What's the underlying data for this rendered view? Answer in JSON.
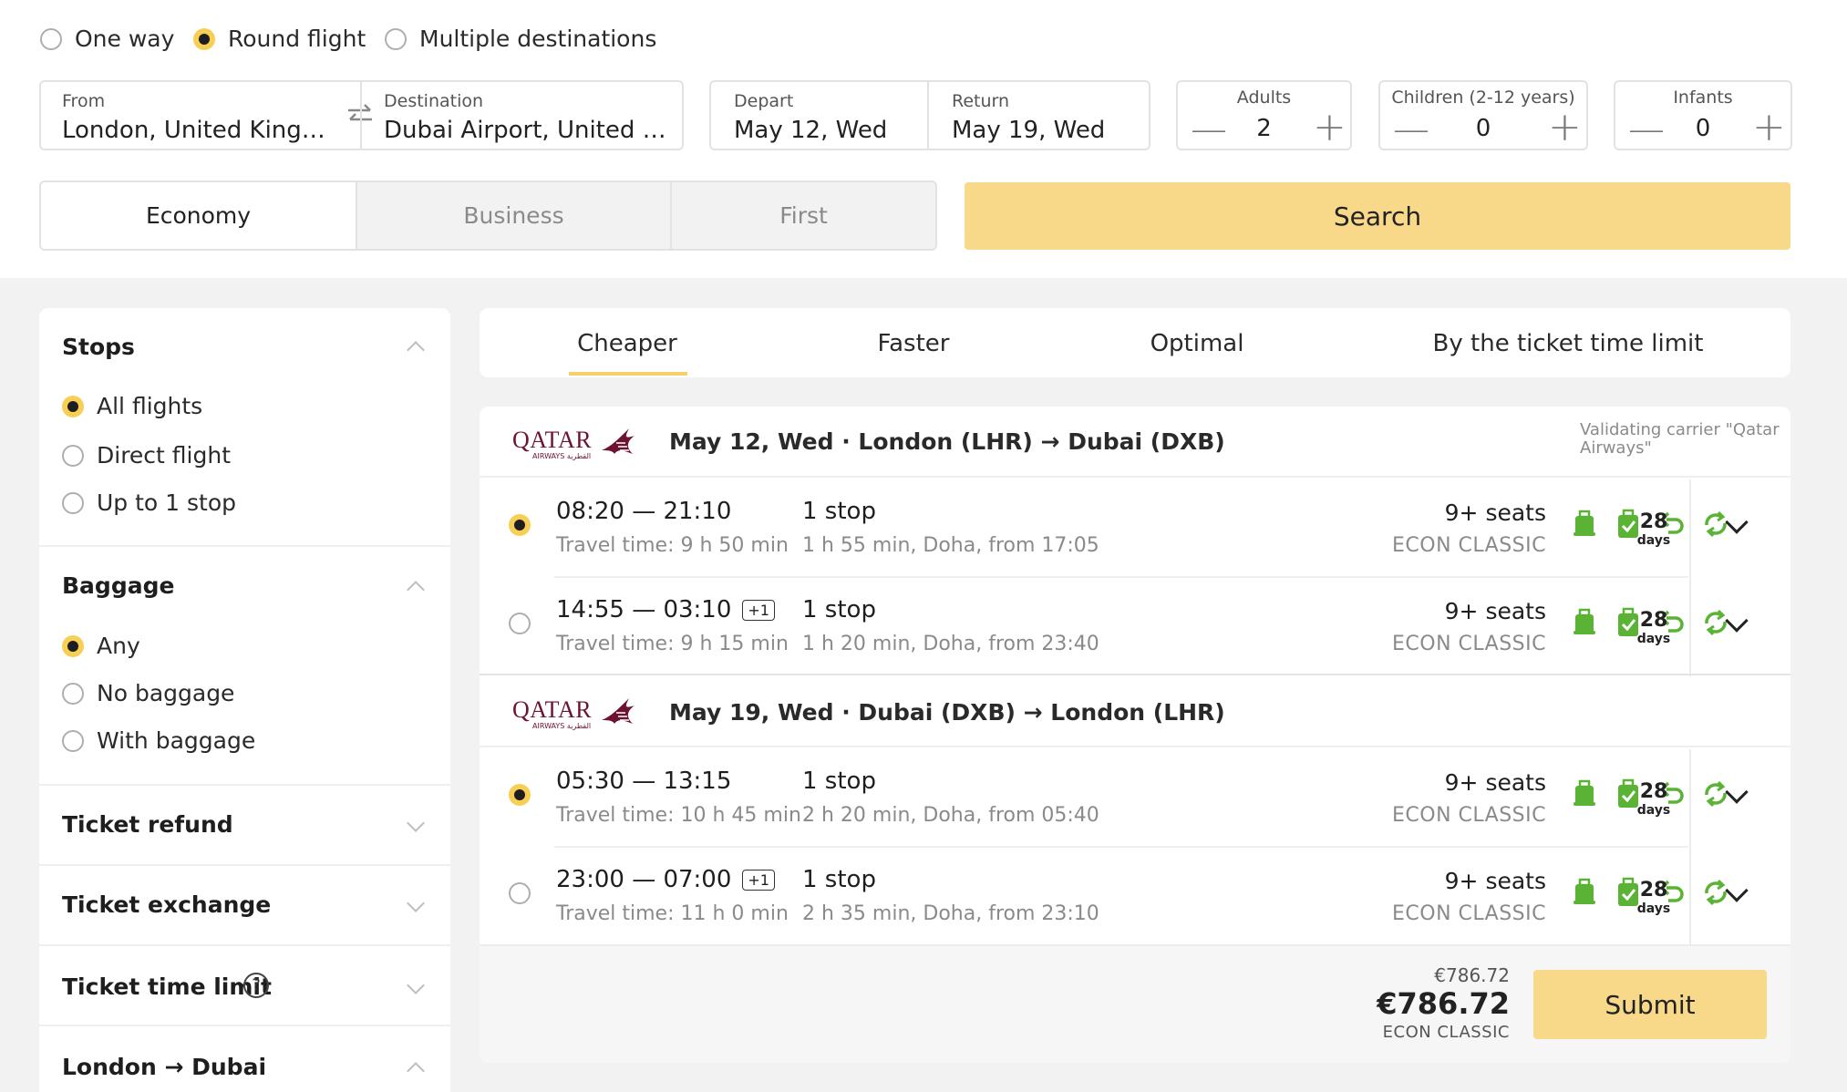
{
  "trip_type": {
    "options": [
      "One way",
      "Round flight",
      "Multiple destinations"
    ],
    "selected": "Round flight"
  },
  "route": {
    "from_label": "From",
    "from_value": "London, United Kingdom",
    "dest_label": "Destination",
    "dest_value": "Dubai Airport, United Arab Emirates"
  },
  "dates": {
    "depart_label": "Depart",
    "depart_value": "May 12, Wed",
    "return_label": "Return",
    "return_value": "May 19, Wed"
  },
  "passengers": {
    "adults_label": "Adults",
    "adults_value": "2",
    "children_label": "Children (2-12 years)",
    "children_value": "0",
    "infants_label": "Infants",
    "infants_value": "0",
    "minus": "—",
    "plus": "+"
  },
  "cabin": {
    "options": [
      "Economy",
      "Business",
      "First"
    ],
    "selected": "Economy"
  },
  "search_label": "Search",
  "filters": {
    "stops": {
      "title": "Stops",
      "options": [
        "All flights",
        "Direct flight",
        "Up to 1 stop"
      ],
      "selected": "All flights"
    },
    "baggage": {
      "title": "Baggage",
      "options": [
        "Any",
        "No baggage",
        "With baggage"
      ],
      "selected": "Any"
    },
    "refund_title": "Ticket refund",
    "exchange_title": "Ticket exchange",
    "time_limit_title": "Ticket time limit",
    "help_glyph": "?",
    "route_title": "London → Dubai"
  },
  "sort_tabs": {
    "options": [
      "Cheaper",
      "Faster",
      "Optimal",
      "By the ticket time limit"
    ],
    "selected": "Cheaper"
  },
  "results": {
    "airline_logo_text": "QATAR",
    "airline_logo_sub": "AIRWAYS القطرية",
    "validating": "Validating carrier \"Qatar Airways\"",
    "legs": [
      {
        "header": "May 12, Wed · London (LHR) → Dubai (DXB)",
        "flights": [
          {
            "selected": true,
            "times": "08:20 — 21:10",
            "plus": "",
            "travel": "Travel time: 9 h 50 min",
            "stops": "1 stop",
            "night": false,
            "stop_detail": "1 h 55 min, Doha, from 17:05",
            "seats": "9+ seats",
            "class": "ECON CLASSIC",
            "days": "28",
            "days_label": "days"
          },
          {
            "selected": false,
            "times": "14:55 — 03:10",
            "plus": "+1",
            "travel": "Travel time: 9 h 15 min",
            "stops": "1 stop",
            "night": true,
            "stop_detail": "1 h 20 min, Doha, from 23:40",
            "seats": "9+ seats",
            "class": "ECON CLASSIC",
            "days": "28",
            "days_label": "days"
          }
        ]
      },
      {
        "header": "May 19, Wed · Dubai (DXB) → London (LHR)",
        "flights": [
          {
            "selected": true,
            "times": "05:30 — 13:15",
            "plus": "",
            "travel": "Travel time: 10 h 45 min",
            "stops": "1 stop",
            "night": false,
            "stop_detail": "2 h 20 min, Doha, from 05:40",
            "seats": "9+ seats",
            "class": "ECON CLASSIC",
            "days": "28",
            "days_label": "days"
          },
          {
            "selected": false,
            "times": "23:00 — 07:00",
            "plus": "+1",
            "travel": "Travel time: 11 h 0 min",
            "stops": "1 stop",
            "night": true,
            "stop_detail": "2 h 35 min, Doha, from 23:10",
            "seats": "9+ seats",
            "class": "ECON CLASSIC",
            "days": "28",
            "days_label": "days"
          }
        ]
      }
    ],
    "price_old": "€786.72",
    "price": "€786.72",
    "price_class": "ECON CLASSIC",
    "submit_label": "Submit"
  },
  "colors": {
    "accent": "#f7d587",
    "radio_on": "#f7cf56",
    "green": "#5bb335",
    "tab_underline": "#f6d06a",
    "logo": "#6d1230"
  },
  "icons": [
    "swap-icon",
    "minus-icon",
    "plus-icon",
    "carry-on-bag-icon",
    "checked-bag-icon",
    "refund-icon",
    "exchange-icon",
    "moon-icon",
    "chevron-down-icon",
    "chevron-up-icon",
    "help-icon"
  ]
}
